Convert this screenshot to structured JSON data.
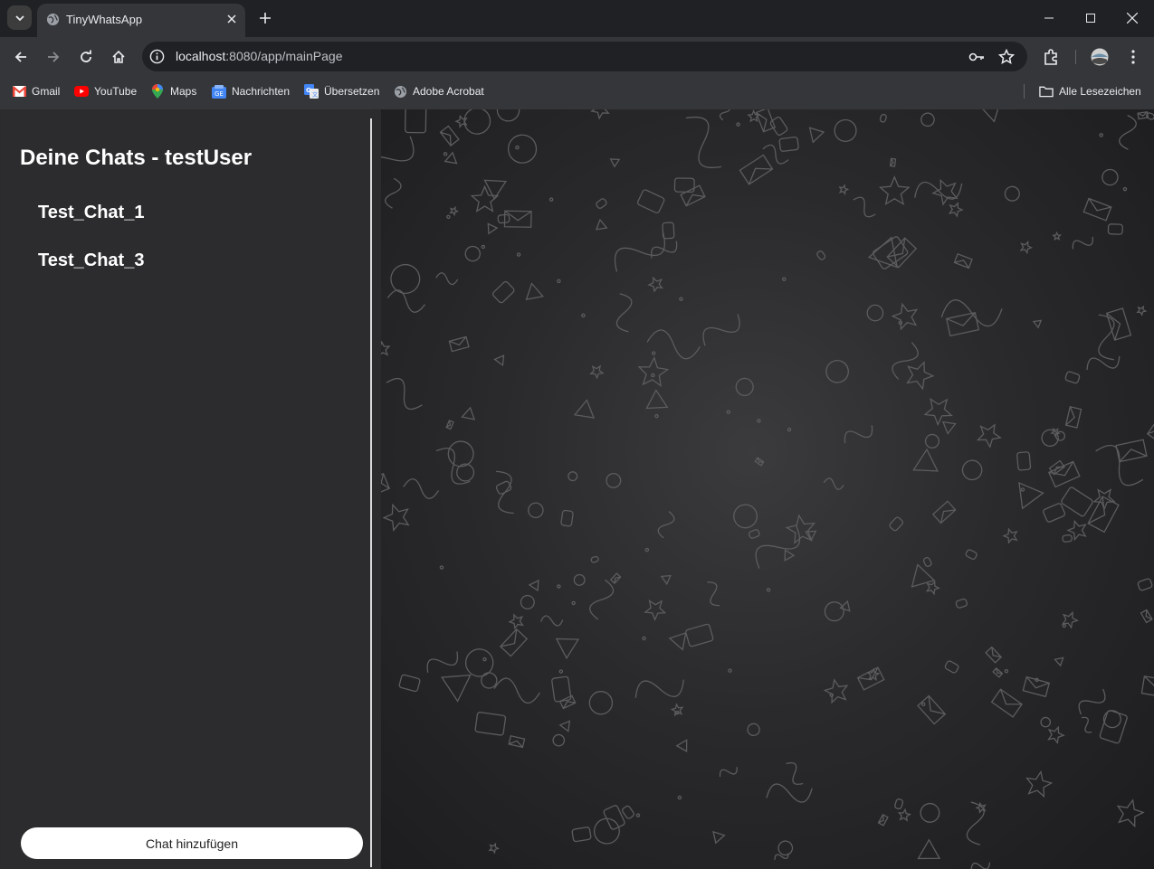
{
  "browser": {
    "tab_title": "TinyWhatsApp",
    "url_host": "localhost",
    "url_rest": ":8080/app/mainPage",
    "bookmarks": [
      {
        "label": "Gmail",
        "icon": "gmail-icon"
      },
      {
        "label": "YouTube",
        "icon": "youtube-icon"
      },
      {
        "label": "Maps",
        "icon": "maps-icon"
      },
      {
        "label": "Nachrichten",
        "icon": "news-icon"
      },
      {
        "label": "Übersetzen",
        "icon": "translate-icon"
      },
      {
        "label": "Adobe Acrobat",
        "icon": "globe-icon"
      }
    ],
    "all_bookmarks_label": "Alle Lesezeichen"
  },
  "sidebar": {
    "title": "Deine Chats - testUser",
    "chats": [
      "Test_Chat_1",
      "Test_Chat_3"
    ],
    "add_chat_label": "Chat hinzufügen"
  },
  "colors": {
    "sidebar_bg": "#2c2c2e",
    "button_bg": "#ffffff",
    "chrome_bg": "#35363a"
  }
}
